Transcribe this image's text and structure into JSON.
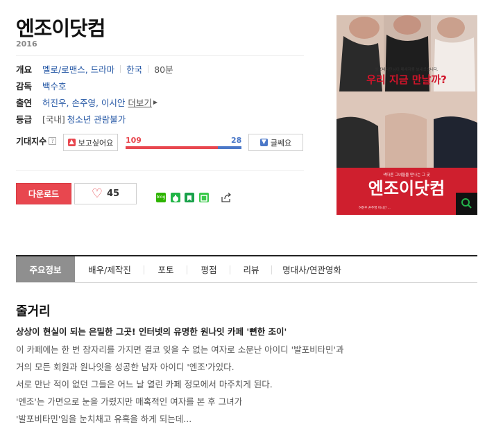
{
  "movie": {
    "title": "엔조이닷컴",
    "year": "2016"
  },
  "info": {
    "genre_label": "개요",
    "genre": "멜로/로맨스, 드라마",
    "country": "한국",
    "runtime": "80분",
    "director_label": "감독",
    "director": "백수호",
    "cast_label": "출연",
    "cast": "허진우, 손주영, 이시안",
    "cast_more": "더보기",
    "rating_label": "등급",
    "rating_prefix": "[국내]",
    "rating": "청소년 관람불가"
  },
  "expect": {
    "label": "기대지수",
    "help": "?",
    "want_label": "보고싶어요",
    "no_label": "글쎄요",
    "want_count": "109",
    "no_count": "28",
    "want_ratio": 0.7956
  },
  "actions": {
    "download_label": "다운로드",
    "like_count": "45"
  },
  "share": {
    "icons": [
      "blog-icon",
      "band-icon",
      "bookmark-icon",
      "line-icon",
      "share-export-icon"
    ],
    "colors": [
      "#2db400",
      "#21b546",
      "#19a14a",
      "#3ac94a"
    ],
    "blog_text": "blog"
  },
  "poster": {
    "tagline_top": "발포비타민님이 메세지를 보내셨습니다.",
    "headline": "우리 지금 만날까?",
    "band_small": "색다른 그녀들을 만나는 그 곳",
    "band_title": "엔조이닷컴",
    "credits": "허진우  손주영  이시안  ...",
    "accent": "#cf1f2e"
  },
  "tabs": [
    {
      "label": "주요정보",
      "active": true
    },
    {
      "label": "배우/제작진",
      "active": false
    },
    {
      "label": "포토",
      "active": false
    },
    {
      "label": "평점",
      "active": false
    },
    {
      "label": "리뷰",
      "active": false
    },
    {
      "label": "명대사/연관영화",
      "active": false
    }
  ],
  "synopsis": {
    "title": "줄거리",
    "headline": "상상이 현실이 되는 은밀한 그곳! 인터넷의 유명한 원나잇 카페 '뻔한 조이'",
    "lines": [
      "이 카페에는 한 번 잠자리를 가지면 결코 잊을 수 없는 여자로 소문난 아이디 '발포비타민'과",
      " 거의 모든 회원과 원나잇을 성공한 남자 아이디 '엔조'가있다.",
      " 서로 만난 적이 없던 그들은 어느 날 열린 카페 정모에서 마주치게 된다.",
      " '엔조'는 가면으로 눈을 가렸지만 매혹적인 여자를 본 후 그녀가",
      " '발포비타민'임을 눈치채고 유혹을 하게 되는데..."
    ]
  }
}
